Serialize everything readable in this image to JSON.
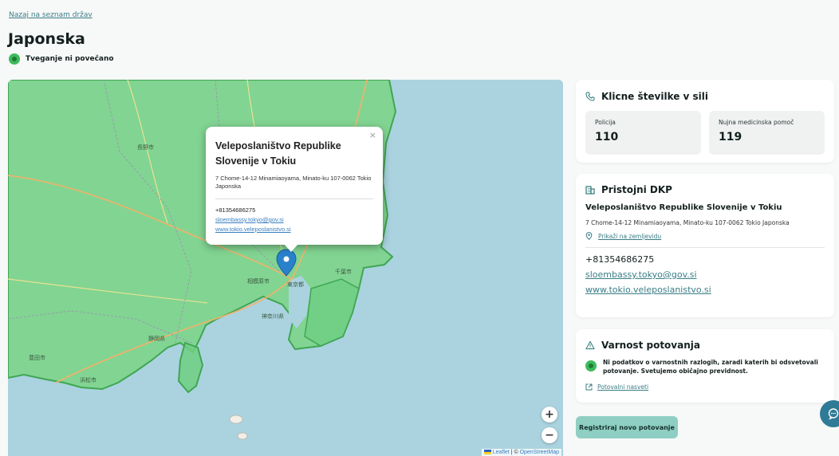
{
  "header": {
    "back_link": "Nazaj na seznam držav",
    "title": "Japonska",
    "status": "Tveganje ni povečano"
  },
  "map": {
    "popup": {
      "close": "×",
      "title": "Veleposlaništvo Republike Slovenije v Tokiu",
      "address": "7 Chome-14-12 Minamiaoyama, Minato-ku 107-0062 Tokio Japonska",
      "phone": "+81354686275",
      "email": "sloembassy.tokyo@gov.si",
      "web": "www.tokio.veleposlanistvo.si"
    },
    "zoom_in": "+",
    "zoom_out": "−",
    "attribution_leaflet": "Leaflet",
    "attribution_sep": " | © ",
    "attribution_osm": "OpenStreetMap",
    "labels": [
      "長野市",
      "相模原市",
      "千葉市",
      "東京都",
      "神奈川県",
      "静岡県",
      "浜松市",
      "豊田市"
    ]
  },
  "emergency": {
    "title": "Klicne številke v sili",
    "items": [
      {
        "label": "Policija",
        "number": "110"
      },
      {
        "label": "Nujna medicinska pomoč",
        "number": "119"
      }
    ]
  },
  "dkp": {
    "title": "Pristojni DKP",
    "name": "Veleposlaništvo Republike Slovenije v Tokiu",
    "address": "7 Chome-14-12 Minamiaoyama, Minato-ku 107-0062 Tokio Japonska",
    "map_link": "Prikaži na zemljevidu",
    "phone": "+81354686275",
    "email": "sloembassy.tokyo@gov.si",
    "web": "www.tokio.veleposlanistvo.si"
  },
  "safety": {
    "title": "Varnost potovanja",
    "text": "Ni podatkov o varnostnih razlogih, zaradi katerih bi odsvetovali potovanje. Svetujemo običajno previdnost.",
    "link": "Potovalni nasveti"
  },
  "register_button": "Registriraj novo potovanje",
  "colors": {
    "accent": "#3a7d86",
    "status_green": "#3dbb5c",
    "button_bg": "#8fcfc3",
    "map_land": "#7fd68f",
    "map_water": "#aad3df"
  }
}
